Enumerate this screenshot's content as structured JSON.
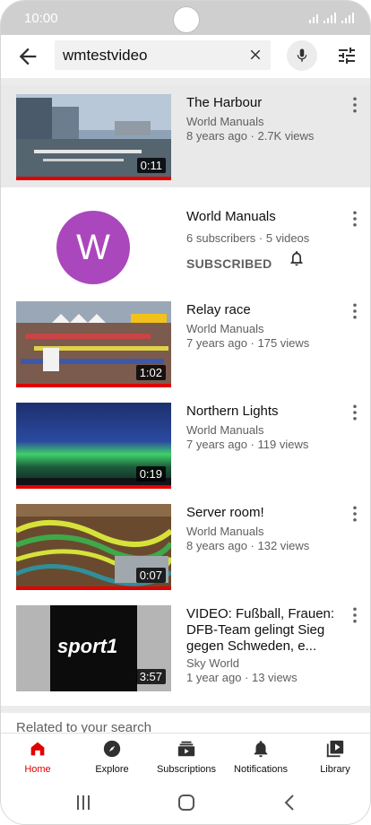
{
  "status_bar": {
    "time": "10:00"
  },
  "search": {
    "query": "wmtestvideo"
  },
  "results": [
    {
      "type": "video",
      "title": "The Harbour",
      "channel": "World Manuals",
      "stats": "8 years ago · 2.7K views",
      "duration": "0:11",
      "watched_fraction": 1.0,
      "highlighted": true
    },
    {
      "type": "channel",
      "avatar_letter": "W",
      "name": "World Manuals",
      "stats": "6 subscribers · 5 videos",
      "subscribe_label": "SUBSCRIBED",
      "avatar_color": "#ab47bc"
    },
    {
      "type": "video",
      "title": "Relay race",
      "channel": "World Manuals",
      "stats": "7 years ago · 175 views",
      "duration": "1:02",
      "watched_fraction": 1.0
    },
    {
      "type": "video",
      "title": "Northern Lights",
      "channel": "World Manuals",
      "stats": "7 years ago · 119 views",
      "duration": "0:19",
      "watched_fraction": 1.0
    },
    {
      "type": "video",
      "title": "Server room!",
      "channel": "World Manuals",
      "stats": "8 years ago · 132 views",
      "duration": "0:07",
      "watched_fraction": 1.0
    },
    {
      "type": "video",
      "title": "VIDEO: Fußball, Frauen: DFB-Team gelingt Sieg gegen Schweden, e...",
      "channel": "Sky World",
      "stats": "1 year ago · 13 views",
      "duration": "3:57",
      "thumb_text": "sport1",
      "watched_fraction": 0
    }
  ],
  "related_heading": "Related to your search",
  "bottom_nav": [
    {
      "label": "Home",
      "icon": "home-icon",
      "active": true
    },
    {
      "label": "Explore",
      "icon": "compass-icon",
      "active": false
    },
    {
      "label": "Subscriptions",
      "icon": "subscriptions-icon",
      "active": false
    },
    {
      "label": "Notifications",
      "icon": "bell-icon",
      "active": false
    },
    {
      "label": "Library",
      "icon": "library-icon",
      "active": false
    }
  ],
  "colors": {
    "accent": "#e00000",
    "avatar": "#ab47bc",
    "highlight_row": "#e9e9e9"
  }
}
